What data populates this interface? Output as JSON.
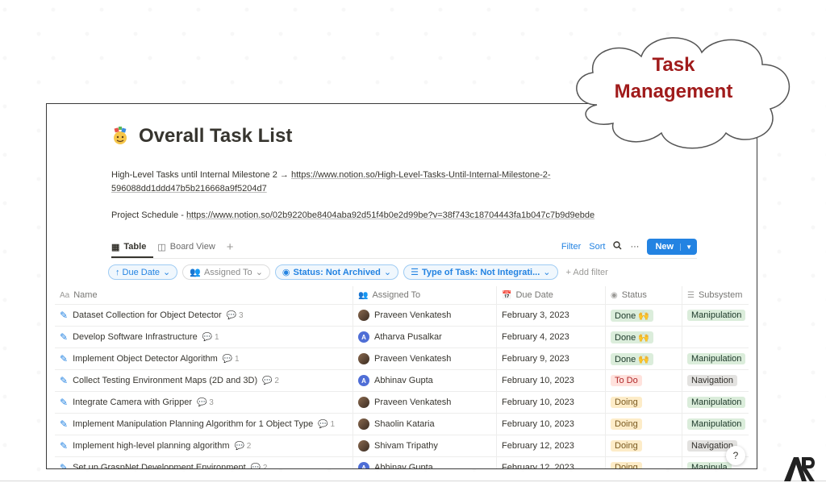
{
  "page": {
    "title": "Overall Task List",
    "description_lines": [
      {
        "prefix": "High-Level Tasks until Internal Milestone 2 → ",
        "link": "https://www.notion.so/High-Level-Tasks-Until-Internal-Milestone-2-",
        "link2": "596088dd1ddd47b5b216668a9f5204d7"
      },
      {
        "prefix": "Project Schedule - ",
        "link": "https://www.notion.so/02b9220be8404aba92d51f4b0e2d99be?v=38f743c18704443fa1b047c7b9d9ebde"
      }
    ]
  },
  "views": {
    "tabs": [
      {
        "label": "Table",
        "icon": "table-icon",
        "active": true
      },
      {
        "label": "Board View",
        "icon": "board-icon",
        "active": false
      }
    ],
    "add": "+",
    "tools": {
      "filter": "Filter",
      "sort": "Sort",
      "more": "···",
      "new": "New"
    }
  },
  "filters": [
    {
      "label": "↑ Due Date",
      "style": "blue"
    },
    {
      "label": "Assigned To",
      "style": "gray"
    },
    {
      "label": "Status: Not Archived",
      "style": "blue"
    },
    {
      "label": "Type of Task: Not Integrati...",
      "style": "blue"
    }
  ],
  "add_filter": "+ Add filter",
  "columns": [
    {
      "label": "Name",
      "icon": "Aa"
    },
    {
      "label": "Assigned To",
      "icon": "people-icon"
    },
    {
      "label": "Due Date",
      "icon": "calendar-icon"
    },
    {
      "label": "Status",
      "icon": "status-icon"
    },
    {
      "label": "Subsystem",
      "icon": "list-icon"
    }
  ],
  "rows": [
    {
      "name": "Dataset Collection for Object Detector",
      "comments": "3",
      "assignee": "Praveen Venkatesh",
      "avatar": "photo",
      "due": "February 3, 2023",
      "status": "Done 🙌",
      "status_kind": "done",
      "subsystem": "Manipulation",
      "sub_kind": "manip"
    },
    {
      "name": "Develop Software Infrastructure",
      "comments": "1",
      "assignee": "Atharva Pusalkar",
      "avatar": "A",
      "due": "February 4, 2023",
      "status": "Done 🙌",
      "status_kind": "done",
      "subsystem": "",
      "sub_kind": ""
    },
    {
      "name": "Implement Object Detector Algorithm",
      "comments": "1",
      "assignee": "Praveen Venkatesh",
      "avatar": "photo",
      "due": "February 9, 2023",
      "status": "Done 🙌",
      "status_kind": "done",
      "subsystem": "Manipulation",
      "sub_kind": "manip"
    },
    {
      "name": "Collect Testing Environment Maps (2D and 3D)",
      "comments": "2",
      "assignee": "Abhinav Gupta",
      "avatar": "A",
      "due": "February 10, 2023",
      "status": "To Do",
      "status_kind": "todo",
      "subsystem": "Navigation",
      "sub_kind": "nav"
    },
    {
      "name": "Integrate Camera with Gripper",
      "comments": "3",
      "assignee": "Praveen Venkatesh",
      "avatar": "photo",
      "due": "February 10, 2023",
      "status": "Doing",
      "status_kind": "doing",
      "subsystem": "Manipulation",
      "sub_kind": "manip"
    },
    {
      "name": "Implement Manipulation Planning Algorithm for 1 Object Type",
      "comments": "1",
      "assignee": "Shaolin Kataria",
      "avatar": "photo",
      "due": "February 10, 2023",
      "status": "Doing",
      "status_kind": "doing",
      "subsystem": "Manipulation",
      "sub_kind": "manip"
    },
    {
      "name": "Implement high-level planning algorithm",
      "comments": "2",
      "assignee": "Shivam Tripathy",
      "avatar": "photo",
      "due": "February 12, 2023",
      "status": "Doing",
      "status_kind": "doing",
      "subsystem": "Navigation",
      "sub_kind": "nav"
    },
    {
      "name": "Set up GraspNet Development Environment",
      "comments": "2",
      "assignee": "Abhinav Gupta",
      "avatar": "A",
      "due": "February 12, 2023",
      "status": "Doing",
      "status_kind": "doing",
      "subsystem": "Manipula",
      "sub_kind": "manip"
    }
  ],
  "help": "?",
  "cloud": {
    "line1": "Task",
    "line2": "Management"
  },
  "colors": {
    "accent": "#2383e2",
    "cloud_text": "#a01b1b"
  }
}
